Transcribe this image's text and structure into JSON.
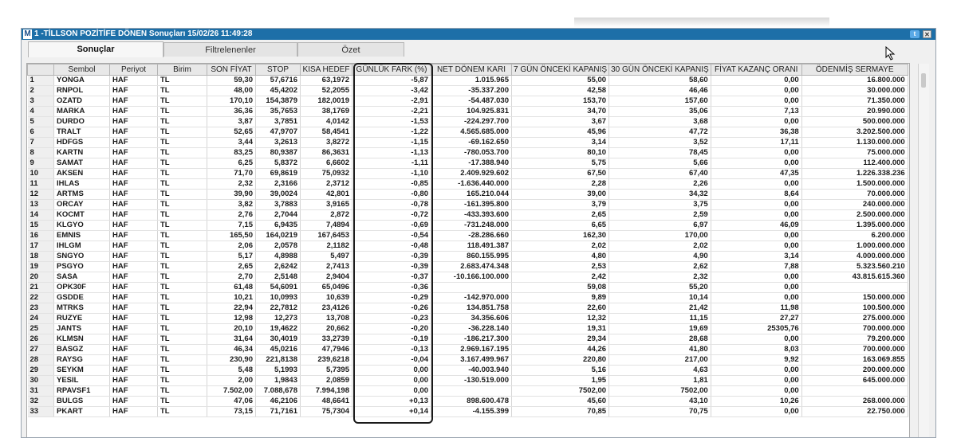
{
  "window": {
    "logo": "M",
    "title": "1 -TİLLSON POZİTİFE DÖNEN Sonuçları  15/02/26 11:49:28",
    "twitter_glyph": "t",
    "close_glyph": "✕"
  },
  "tabs": [
    {
      "label": "Sonuçlar",
      "active": true
    },
    {
      "label": "Filtrelenenler",
      "active": false
    },
    {
      "label": "Özet",
      "active": false
    }
  ],
  "table": {
    "columns": [
      "",
      "Sembol",
      "Periyot",
      "Birim",
      "SON FİYAT",
      "STOP",
      "KISA HEDEF",
      "GÜNLÜK FARK (%)",
      "NET DÖNEM KARI",
      "7 GÜN ÖNCEKİ KAPANIŞ",
      "30 GÜN ÖNCEKİ KAPANIŞ",
      "FİYAT KAZANÇ ORANI",
      "ÖDENMİŞ SERMAYE"
    ],
    "rows": [
      [
        "1",
        "YONGA",
        "HAF",
        "TL",
        "59,30",
        "57,6716",
        "63,1972",
        "-5,87",
        "1.015.965",
        "55,00",
        "58,60",
        "0,00",
        "16.800.000"
      ],
      [
        "2",
        "RNPOL",
        "HAF",
        "TL",
        "48,00",
        "45,4202",
        "52,2055",
        "-3,42",
        "-35.337.200",
        "42,58",
        "46,46",
        "0,00",
        "30.000.000"
      ],
      [
        "3",
        "OZATD",
        "HAF",
        "TL",
        "170,10",
        "154,3879",
        "182,0019",
        "-2,91",
        "-54.487.030",
        "153,70",
        "157,60",
        "0,00",
        "71.350.000"
      ],
      [
        "4",
        "MARKA",
        "HAF",
        "TL",
        "36,36",
        "35,7653",
        "38,1769",
        "-2,21",
        "104.925.831",
        "34,70",
        "35,06",
        "7,13",
        "20.990.000"
      ],
      [
        "5",
        "DURDO",
        "HAF",
        "TL",
        "3,87",
        "3,7851",
        "4,0142",
        "-1,53",
        "-224.297.700",
        "3,67",
        "3,68",
        "0,00",
        "500.000.000"
      ],
      [
        "6",
        "TRALT",
        "HAF",
        "TL",
        "52,65",
        "47,9707",
        "58,4541",
        "-1,22",
        "4.565.685.000",
        "45,96",
        "47,72",
        "36,38",
        "3.202.500.000"
      ],
      [
        "7",
        "HDFGS",
        "HAF",
        "TL",
        "3,44",
        "3,2613",
        "3,8272",
        "-1,15",
        "-69.162.650",
        "3,14",
        "3,52",
        "17,11",
        "1.130.000.000"
      ],
      [
        "8",
        "KARTN",
        "HAF",
        "TL",
        "83,25",
        "80,9387",
        "86,3631",
        "-1,13",
        "-780.053.700",
        "80,10",
        "78,45",
        "0,00",
        "75.000.000"
      ],
      [
        "9",
        "SAMAT",
        "HAF",
        "TL",
        "6,25",
        "5,8372",
        "6,6602",
        "-1,11",
        "-17.388.940",
        "5,75",
        "5,66",
        "0,00",
        "112.400.000"
      ],
      [
        "10",
        "AKSEN",
        "HAF",
        "TL",
        "71,70",
        "69,8619",
        "75,0932",
        "-1,10",
        "2.409.929.602",
        "67,50",
        "67,40",
        "47,35",
        "1.226.338.236"
      ],
      [
        "11",
        "IHLAS",
        "HAF",
        "TL",
        "2,32",
        "2,3166",
        "2,3712",
        "-0,85",
        "-1.636.440.000",
        "2,28",
        "2,26",
        "0,00",
        "1.500.000.000"
      ],
      [
        "12",
        "ARTMS",
        "HAF",
        "TL",
        "39,90",
        "39,0024",
        "42,801",
        "-0,80",
        "165.210.044",
        "39,00",
        "34,32",
        "8,64",
        "70.000.000"
      ],
      [
        "13",
        "ORCAY",
        "HAF",
        "TL",
        "3,82",
        "3,7883",
        "3,9165",
        "-0,78",
        "-161.395.800",
        "3,79",
        "3,75",
        "0,00",
        "240.000.000"
      ],
      [
        "14",
        "KOCMT",
        "HAF",
        "TL",
        "2,76",
        "2,7044",
        "2,872",
        "-0,72",
        "-433.393.600",
        "2,65",
        "2,59",
        "0,00",
        "2.500.000.000"
      ],
      [
        "15",
        "KLGYO",
        "HAF",
        "TL",
        "7,15",
        "6,9435",
        "7,4894",
        "-0,69",
        "-731.248.000",
        "6,65",
        "6,97",
        "46,09",
        "1.395.000.000"
      ],
      [
        "16",
        "EMNIS",
        "HAF",
        "TL",
        "165,50",
        "164,0219",
        "167,6453",
        "-0,54",
        "-28.286.660",
        "162,30",
        "170,00",
        "0,00",
        "6.200.000"
      ],
      [
        "17",
        "IHLGM",
        "HAF",
        "TL",
        "2,06",
        "2,0578",
        "2,1182",
        "-0,48",
        "118.491.387",
        "2,02",
        "2,02",
        "0,00",
        "1.000.000.000"
      ],
      [
        "18",
        "SNGYO",
        "HAF",
        "TL",
        "5,17",
        "4,8988",
        "5,497",
        "-0,39",
        "860.155.995",
        "4,80",
        "4,90",
        "3,14",
        "4.000.000.000"
      ],
      [
        "19",
        "PSGYO",
        "HAF",
        "TL",
        "2,65",
        "2,6242",
        "2,7413",
        "-0,39",
        "2.683.474.348",
        "2,53",
        "2,62",
        "7,88",
        "5.323.560.210"
      ],
      [
        "20",
        "SASA",
        "HAF",
        "TL",
        "2,70",
        "2,5148",
        "2,9404",
        "-0,37",
        "-10.166.100.000",
        "2,42",
        "2,32",
        "0,00",
        "43.815.615.360"
      ],
      [
        "21",
        "OPK30F",
        "HAF",
        "TL",
        "61,48",
        "54,6091",
        "65,0496",
        "-0,36",
        "",
        "59,08",
        "55,20",
        "0,00",
        ""
      ],
      [
        "22",
        "GSDDE",
        "HAF",
        "TL",
        "10,21",
        "10,0993",
        "10,639",
        "-0,29",
        "-142.970.000",
        "9,89",
        "10,14",
        "0,00",
        "150.000.000"
      ],
      [
        "23",
        "MTRKS",
        "HAF",
        "TL",
        "22,94",
        "22,7812",
        "23,4126",
        "-0,26",
        "134.851.758",
        "22,60",
        "21,42",
        "11,98",
        "100.500.000"
      ],
      [
        "24",
        "RUZYE",
        "HAF",
        "TL",
        "12,98",
        "12,273",
        "13,708",
        "-0,23",
        "34.356.606",
        "12,32",
        "11,15",
        "27,27",
        "275.000.000"
      ],
      [
        "25",
        "JANTS",
        "HAF",
        "TL",
        "20,10",
        "19,4622",
        "20,662",
        "-0,20",
        "-36.228.140",
        "19,31",
        "19,69",
        "25305,76",
        "700.000.000"
      ],
      [
        "26",
        "KLMSN",
        "HAF",
        "TL",
        "31,64",
        "30,4019",
        "33,2739",
        "-0,19",
        "-186.217.300",
        "29,34",
        "28,68",
        "0,00",
        "79.200.000"
      ],
      [
        "27",
        "BASGZ",
        "HAF",
        "TL",
        "46,34",
        "45,0216",
        "47,7946",
        "-0,13",
        "2.969.167.195",
        "44,26",
        "41,80",
        "8,03",
        "700.000.000"
      ],
      [
        "28",
        "RAYSG",
        "HAF",
        "TL",
        "230,90",
        "221,8138",
        "239,6218",
        "-0,04",
        "3.167.499.967",
        "220,80",
        "217,00",
        "9,92",
        "163.069.855"
      ],
      [
        "29",
        "SEYKM",
        "HAF",
        "TL",
        "5,48",
        "5,1993",
        "5,7395",
        "0,00",
        "-40.003.940",
        "5,16",
        "4,63",
        "0,00",
        "200.000.000"
      ],
      [
        "30",
        "YESIL",
        "HAF",
        "TL",
        "2,00",
        "1,9843",
        "2,0859",
        "0,00",
        "-130.519.000",
        "1,95",
        "1,81",
        "0,00",
        "645.000.000"
      ],
      [
        "31",
        "RPAVSF1",
        "HAF",
        "TL",
        "7.502,00",
        "7.088,678",
        "7.994,198",
        "0,00",
        "",
        "7502,00",
        "7502,00",
        "0,00",
        ""
      ],
      [
        "32",
        "BULGS",
        "HAF",
        "TL",
        "47,06",
        "46,2106",
        "48,6641",
        "+0,13",
        "898.600.478",
        "45,60",
        "43,10",
        "10,26",
        "268.000.000"
      ],
      [
        "33",
        "PKART",
        "HAF",
        "TL",
        "73,15",
        "71,7161",
        "75,7304",
        "+0,14",
        "-4.155.399",
        "70,85",
        "70,75",
        "0,00",
        "22.750.000"
      ]
    ]
  }
}
